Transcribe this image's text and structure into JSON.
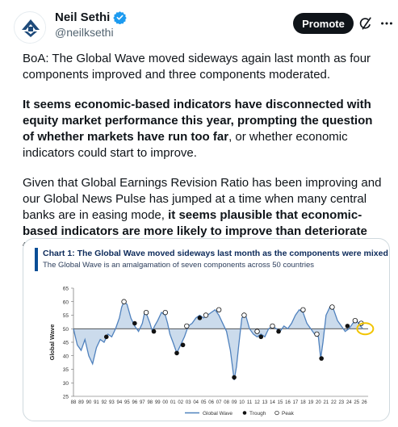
{
  "author": {
    "name": "Neil Sethi",
    "handle": "@neilksethi"
  },
  "header": {
    "promote_label": "Promote"
  },
  "tweet": {
    "p1": "BoA: The Global Wave moved sideways again last month as four components improved and three components moderated.",
    "p2_bold": "It seems economic-based indicators have disconnected with equity market performance this year, prompting the question of whether markets have run too far",
    "p2_rest": ", or whether economic indicators could start to improve.",
    "p3_start": "Given that Global Earnings Revision Ratio has been improving and our Global News Pulse has jumped at a time when many central banks are in easing mode, ",
    "p3_bold": "it seems plausible that economic-based indicators are more likely to improve than deteriorate from this point."
  },
  "colors": {
    "accent": "#0f1419",
    "verified": "#1d9bf0",
    "wave_line": "#4f81bd",
    "wave_fill": "#b9cfe6",
    "highlight_circle": "#f2c400"
  },
  "chart_data": {
    "type": "area",
    "title": "Chart 1:  The Global Wave moved sideways last month as the components were mixed",
    "subtitle": "The Global Wave is an amalgamation of seven components across 50 countries",
    "ylabel": "Global Wave",
    "baseline": 50,
    "ylim": [
      25,
      65
    ],
    "yticks": [
      25,
      30,
      35,
      40,
      45,
      50,
      55,
      60,
      65
    ],
    "xtick_labels": [
      "88",
      "89",
      "90",
      "91",
      "92",
      "93",
      "94",
      "95",
      "96",
      "97",
      "98",
      "99",
      "00",
      "01",
      "02",
      "03",
      "04",
      "05",
      "06",
      "07",
      "08",
      "09",
      "10",
      "11",
      "12",
      "13",
      "14",
      "15",
      "16",
      "17",
      "18",
      "19",
      "20",
      "21",
      "22",
      "23",
      "24",
      "25",
      "26"
    ],
    "legend": [
      "Global Wave",
      "Trough",
      "Peak"
    ],
    "series": [
      {
        "name": "Global Wave",
        "x": [
          1988.0,
          1988.5,
          1989.0,
          1989.5,
          1990.0,
          1990.5,
          1991.0,
          1991.5,
          1992.0,
          1992.5,
          1993.0,
          1993.5,
          1994.0,
          1994.3,
          1994.6,
          1995.0,
          1995.5,
          1996.0,
          1996.5,
          1997.0,
          1997.3,
          1997.6,
          1998.0,
          1998.3,
          1998.6,
          1999.0,
          1999.5,
          2000.0,
          2000.3,
          2000.6,
          2001.0,
          2001.5,
          2002.0,
          2002.5,
          2003.0,
          2003.5,
          2004.0,
          2004.5,
          2005.0,
          2005.5,
          2006.0,
          2006.5,
          2007.0,
          2007.5,
          2008.0,
          2008.5,
          2009.0,
          2009.3,
          2009.6,
          2010.0,
          2010.5,
          2011.0,
          2011.5,
          2012.0,
          2012.5,
          2013.0,
          2013.5,
          2014.0,
          2014.5,
          2015.0,
          2015.5,
          2016.0,
          2016.5,
          2017.0,
          2017.5,
          2018.0,
          2018.5,
          2019.0,
          2019.5,
          2020.0,
          2020.3,
          2020.6,
          2021.0,
          2021.5,
          2022.0,
          2022.5,
          2023.0,
          2023.5,
          2024.0,
          2024.5,
          2025.0,
          2025.5,
          2025.8
        ],
        "values": [
          50,
          44,
          42,
          46,
          40,
          37,
          43,
          46,
          45,
          48,
          47,
          50,
          54,
          58,
          60,
          59,
          54,
          51,
          49,
          52,
          56,
          55,
          52,
          49,
          51,
          53,
          56,
          55,
          52,
          48,
          45,
          41,
          44,
          47,
          51,
          52,
          54,
          55,
          54,
          55,
          56,
          57,
          55,
          52,
          49,
          42,
          31,
          36,
          44,
          54,
          55,
          50,
          48,
          47,
          48,
          47,
          50,
          51,
          50,
          49,
          51,
          50,
          52,
          55,
          57,
          56,
          52,
          50,
          48,
          47,
          39,
          45,
          55,
          58,
          57,
          53,
          51,
          49,
          50,
          52,
          53,
          51,
          50
        ]
      }
    ],
    "troughs": [
      {
        "x": 1992.3,
        "y": 47
      },
      {
        "x": 1996.0,
        "y": 52
      },
      {
        "x": 1998.5,
        "y": 49
      },
      {
        "x": 2001.5,
        "y": 41
      },
      {
        "x": 2002.3,
        "y": 44
      },
      {
        "x": 2004.5,
        "y": 54
      },
      {
        "x": 2009.0,
        "y": 32
      },
      {
        "x": 2012.5,
        "y": 47
      },
      {
        "x": 2014.8,
        "y": 49
      },
      {
        "x": 2020.4,
        "y": 39
      },
      {
        "x": 2023.8,
        "y": 51
      }
    ],
    "peaks": [
      {
        "x": 1994.6,
        "y": 60
      },
      {
        "x": 1997.5,
        "y": 56
      },
      {
        "x": 2000.0,
        "y": 56
      },
      {
        "x": 2002.8,
        "y": 51
      },
      {
        "x": 2005.3,
        "y": 55
      },
      {
        "x": 2007.0,
        "y": 57
      },
      {
        "x": 2010.3,
        "y": 55
      },
      {
        "x": 2012.0,
        "y": 49
      },
      {
        "x": 2014.0,
        "y": 51
      },
      {
        "x": 2018.0,
        "y": 57
      },
      {
        "x": 2019.8,
        "y": 48
      },
      {
        "x": 2021.8,
        "y": 58
      },
      {
        "x": 2024.8,
        "y": 53
      },
      {
        "x": 2025.6,
        "y": 52
      }
    ]
  }
}
